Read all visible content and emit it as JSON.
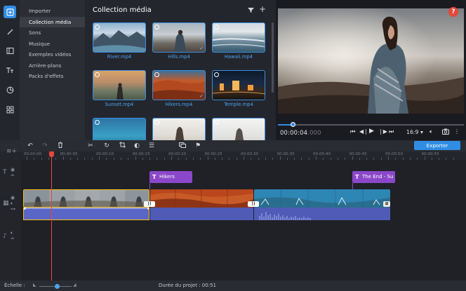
{
  "sidebar": {
    "icons": [
      "import-icon",
      "magic-wand-icon",
      "transitions-icon",
      "titles-icon",
      "clock-icon",
      "grid-icon"
    ],
    "categories": [
      {
        "label": "Importer"
      },
      {
        "label": "Collection média",
        "active": true
      },
      {
        "label": "Sons"
      },
      {
        "label": "Musique"
      },
      {
        "label": "Exemples vidéos"
      },
      {
        "label": "Arrière-plans"
      },
      {
        "label": "Packs d'effets"
      }
    ]
  },
  "media": {
    "title": "Collection média",
    "clips": [
      {
        "name": "River.mp4"
      },
      {
        "name": "Hills.mp4"
      },
      {
        "name": "Hawaii.mp4"
      },
      {
        "name": "Sunset.mp4"
      },
      {
        "name": "Hikers.mp4"
      },
      {
        "name": "Temple.mp4"
      },
      {
        "name": ""
      },
      {
        "name": ""
      },
      {
        "name": ""
      }
    ]
  },
  "preview": {
    "help": "?",
    "timecode_main": "00:00:04",
    "timecode_dim": ".000",
    "aspect_ratio": "16:9 ▾",
    "progress": 0.08
  },
  "toolbar": {
    "export_label": "Exporter"
  },
  "ruler": {
    "labels": [
      "00:00:00",
      "00:00:05",
      "00:00:10",
      "00:00:15",
      "00:00:20",
      "00:00:25",
      "00:00:30",
      "00:00:35",
      "00:00:40",
      "00:00:45",
      "00:00:50",
      "00:00:55"
    ]
  },
  "timeline": {
    "titles": [
      {
        "label": "Hikers"
      },
      {
        "label": "The End - Su"
      }
    ]
  },
  "status": {
    "scale_label": "Échelle :",
    "duration": "Durée du projet :  00:51"
  },
  "colors": {
    "accent": "#2f8de4",
    "playhead": "#e4473b",
    "title_clip": "#8b47c9",
    "audio_clip": "#4f5bb6"
  }
}
